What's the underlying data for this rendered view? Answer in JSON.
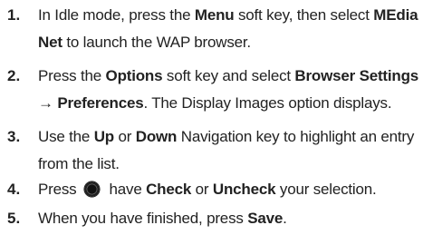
{
  "steps": [
    {
      "num": "1.",
      "line1": {
        "a": "In Idle mode, press the ",
        "b": "Menu",
        "c": " soft key, then select ",
        "d": "MEdia"
      },
      "line2": {
        "a": "Net",
        "b": " to launch the WAP browser."
      }
    },
    {
      "num": "2.",
      "line1": {
        "a": "Press the ",
        "b": "Options",
        "c": " soft key and select ",
        "d": "Browser Settings"
      },
      "line2": {
        "a": "→ Preferences",
        "b": ". The Display Images option displays."
      }
    },
    {
      "num": "3.",
      "line1": {
        "a": "Use the ",
        "b": "Up",
        "c": " or ",
        "d": "Down",
        "e": " Navigation key to highlight an entry"
      },
      "line2": {
        "a": "from the list."
      }
    },
    {
      "num": "4.",
      "line1": {
        "a": "Press ",
        "icon": "center-select-key-icon",
        "b": " have ",
        "c": "Check",
        "d": " or ",
        "e": "Uncheck",
        "f": " your selection."
      }
    },
    {
      "num": "5.",
      "line1": {
        "a": "When you have finished, press ",
        "b": "Save",
        "c": "."
      }
    }
  ]
}
